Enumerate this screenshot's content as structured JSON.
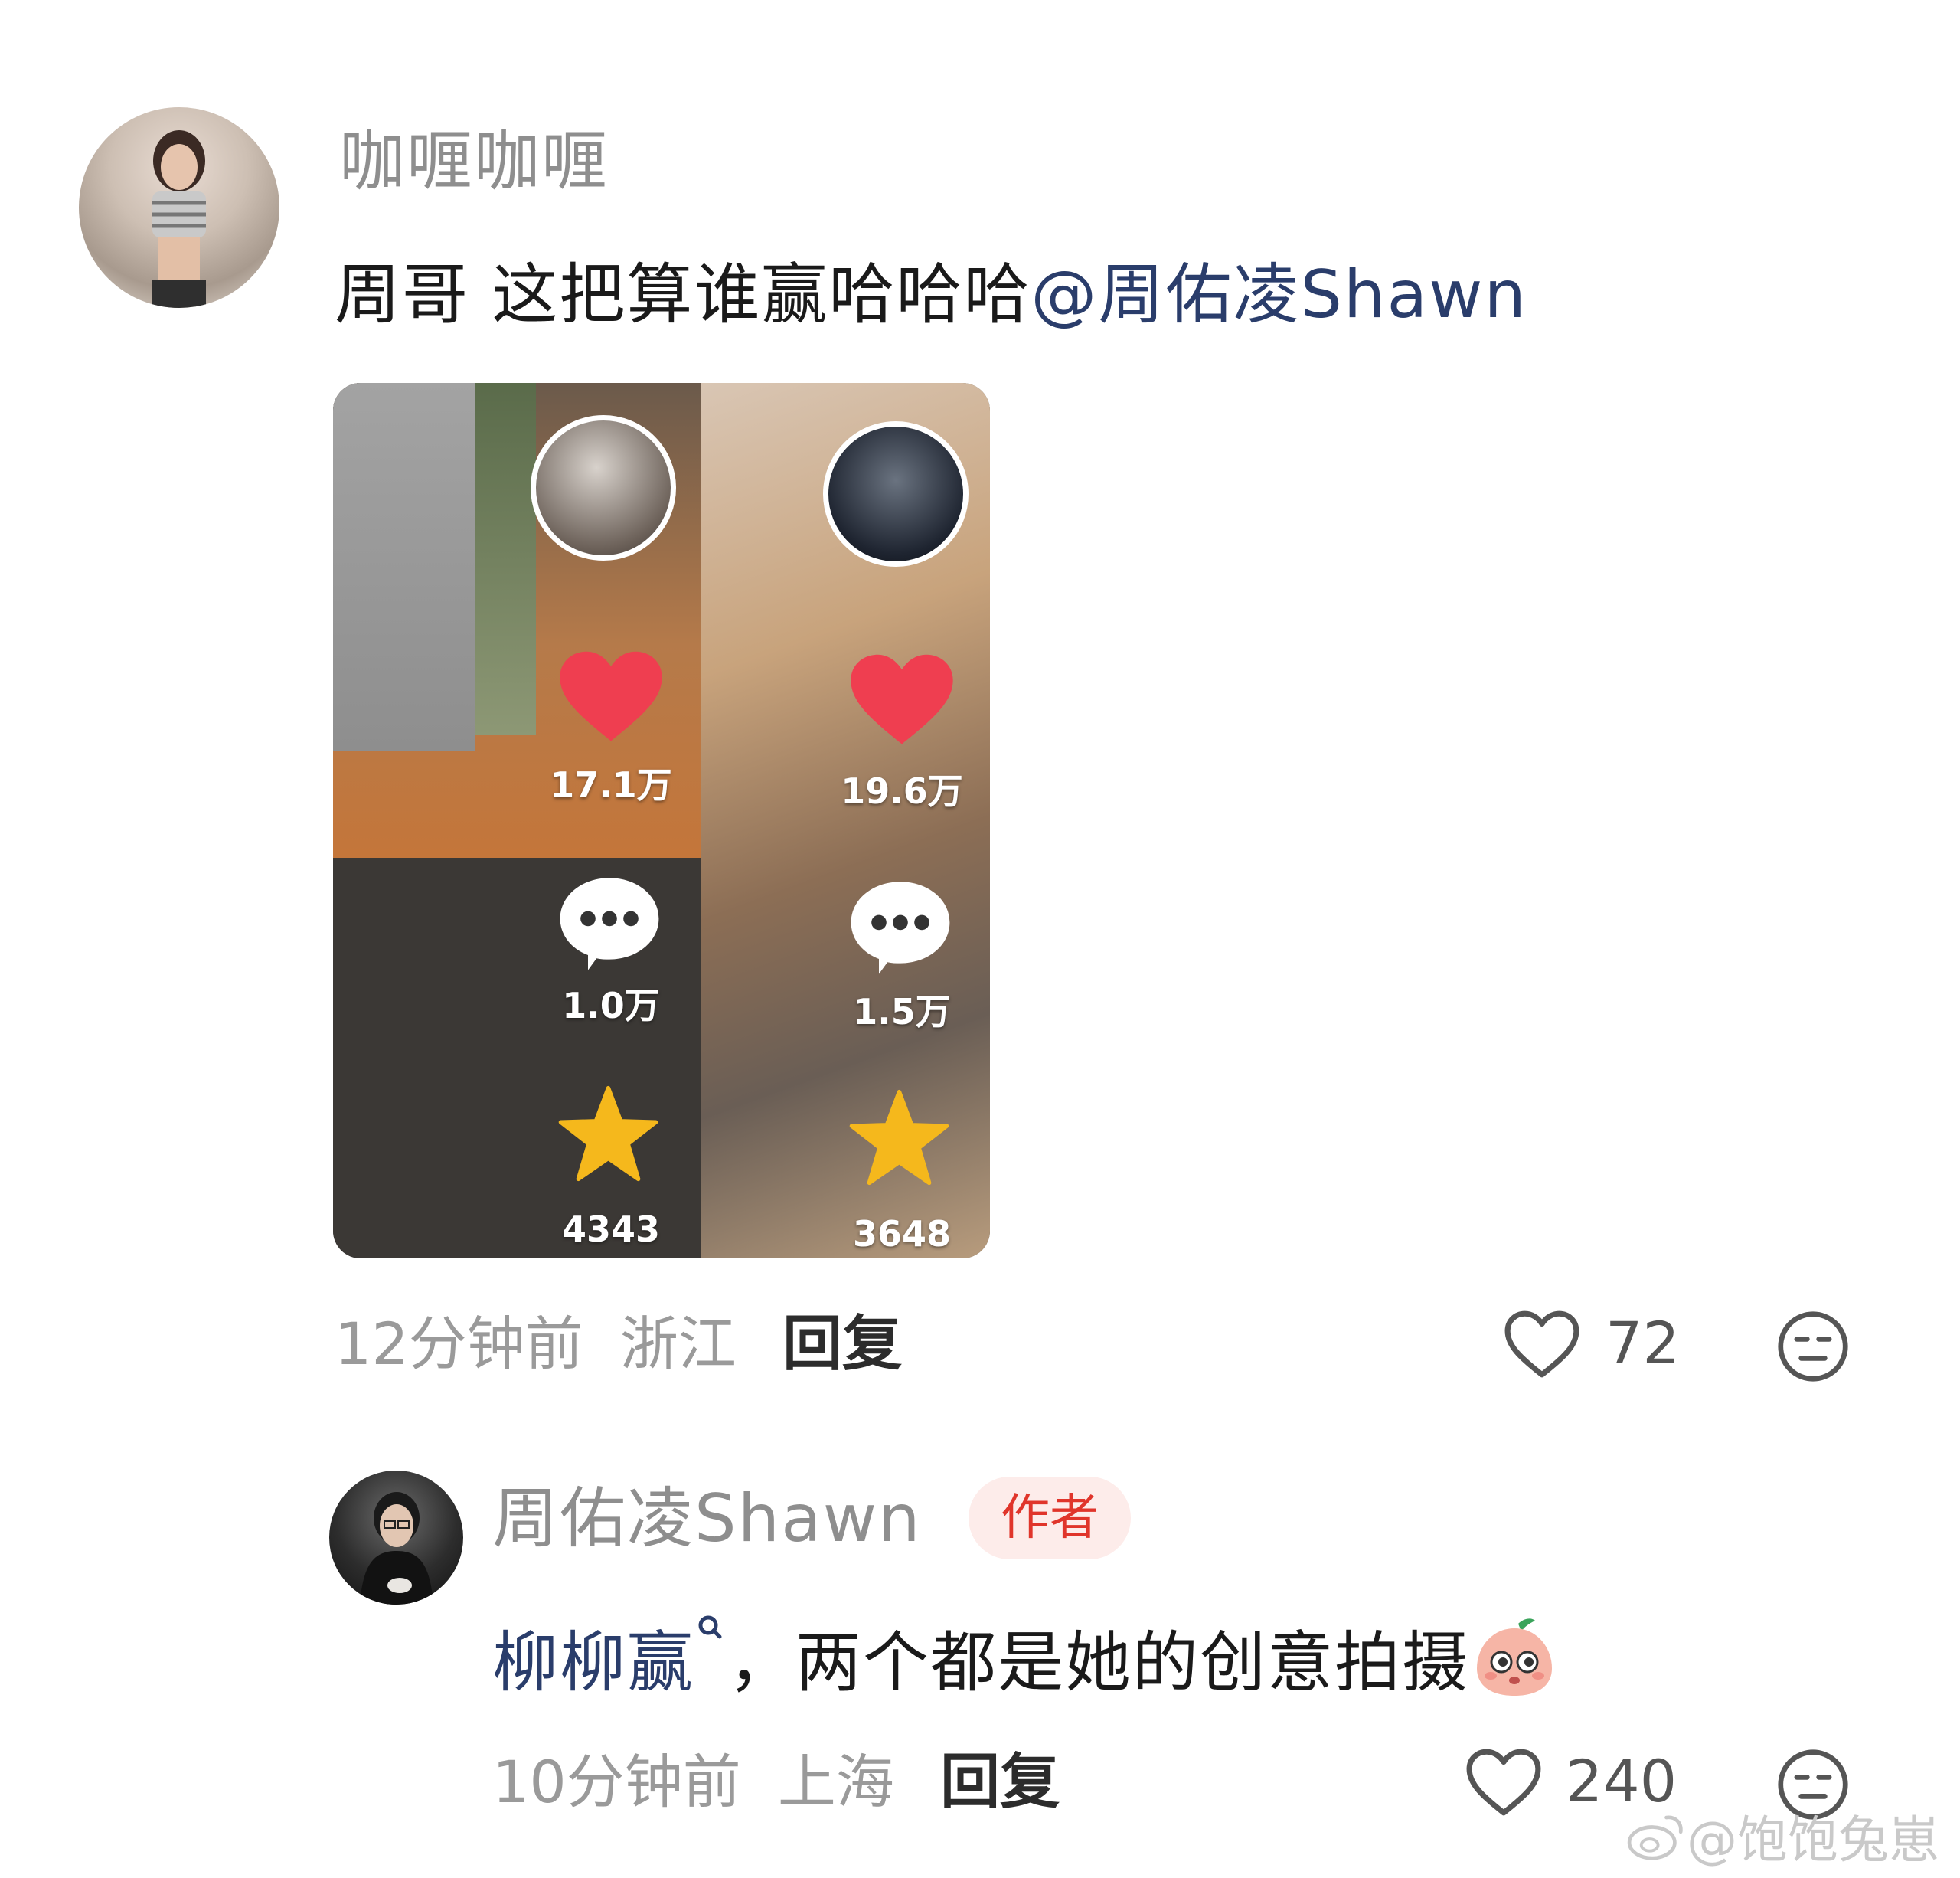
{
  "comments": [
    {
      "username": "咖喱咖喱",
      "text_plain": "周哥 这把算谁赢哈哈哈",
      "mention": "@周佑凌Shawn",
      "image_stats": {
        "left": {
          "likes": "17.1万",
          "comments": "1.0万",
          "favorites": "4343"
        },
        "right": {
          "likes": "19.6万",
          "comments": "1.5万",
          "favorites": "3648"
        }
      },
      "time": "12分钟前",
      "location": "浙江",
      "reply_label": "回复",
      "like_count": "72"
    },
    {
      "username": "周佑凌Shawn",
      "badge": "作者",
      "mention": "柳柳赢",
      "text_plain": "，两个都是她的创意拍摄",
      "time": "10分钟前",
      "location": "上海",
      "reply_label": "回复",
      "like_count": "240"
    }
  ],
  "watermark": "@饱饱兔崽",
  "icons": {
    "like": "heart-outline-icon",
    "dislike": "neutral-face-icon",
    "mention_tag": "search-tag-icon",
    "emoji": "peach-emoji-icon"
  },
  "colors": {
    "mention": "#2a3d6b",
    "badge_text": "#e0352b",
    "badge_bg": "#fdecea",
    "heart_red": "#ef3e50",
    "star_yellow": "#f5b81c"
  }
}
